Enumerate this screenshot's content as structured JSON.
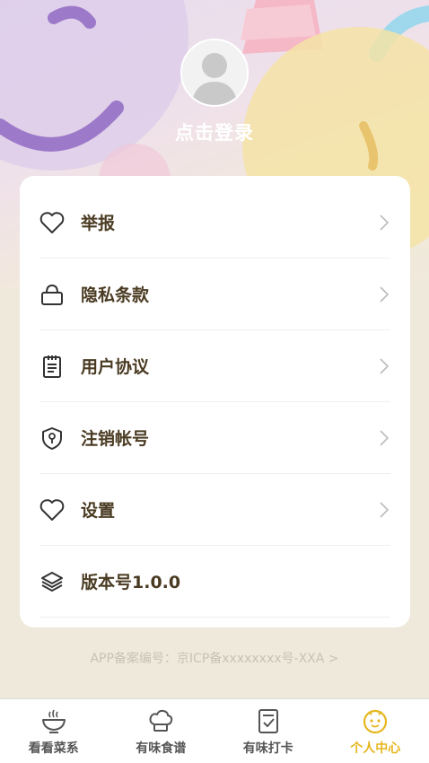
{
  "profile": {
    "login_label": "点击登录"
  },
  "menu": {
    "items": [
      {
        "label": "举报",
        "icon": "heart-icon"
      },
      {
        "label": "隐私条款",
        "icon": "lock-icon"
      },
      {
        "label": "用户协议",
        "icon": "notepad-icon"
      },
      {
        "label": "注销帐号",
        "icon": "shield-key-icon"
      },
      {
        "label": "设置",
        "icon": "heart-icon"
      },
      {
        "label": "版本号1.0.0",
        "icon": "layers-icon"
      }
    ]
  },
  "footer": {
    "icp_text": "APP备案编号：京ICP备xxxxxxxx号-XXA >"
  },
  "tabbar": {
    "tabs": [
      {
        "label": "看看菜系",
        "icon": "bowl-icon"
      },
      {
        "label": "有味食谱",
        "icon": "chef-hat-icon"
      },
      {
        "label": "有味打卡",
        "icon": "checkin-icon"
      },
      {
        "label": "个人中心",
        "icon": "smiley-icon",
        "active": true
      }
    ]
  },
  "colors": {
    "accent": "#e6b61e",
    "text_dark": "#4a3b22",
    "background": "#efe9dc"
  }
}
